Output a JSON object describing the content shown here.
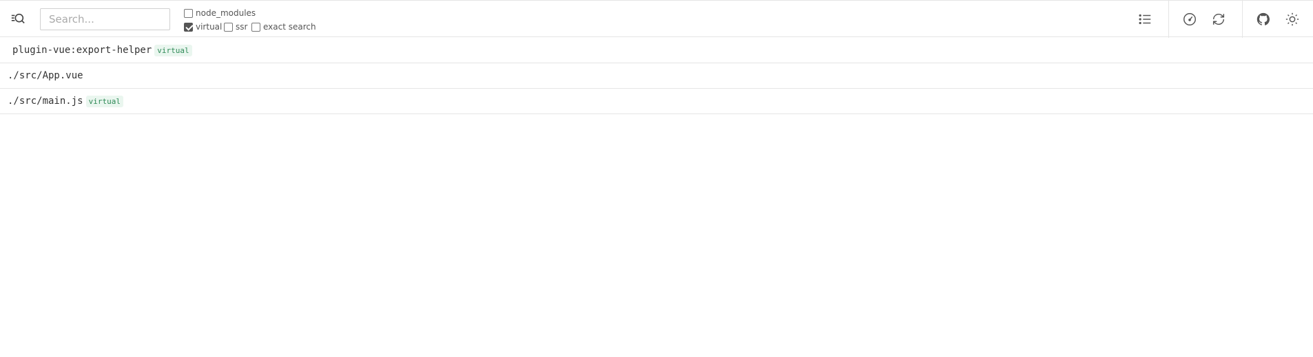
{
  "toolbar": {
    "logo_icon": "inspect-search-icon",
    "search": {
      "placeholder": "Search...",
      "value": ""
    },
    "filters": [
      {
        "label": "node_modules",
        "checked": false
      },
      {
        "label": "virtual",
        "checked": true
      },
      {
        "label": "ssr",
        "checked": false
      },
      {
        "label": "exact search",
        "checked": false
      }
    ],
    "right_icons": [
      "list-icon",
      "gauge-icon",
      "refresh-icon",
      "github-icon",
      "sun-icon"
    ]
  },
  "modules": [
    {
      "path": "plugin-vue:export-helper",
      "badge": "virtual"
    },
    {
      "path": "./src/App.vue",
      "badge": ""
    },
    {
      "path": "./src/main.js",
      "badge": "virtual"
    }
  ],
  "colors": {
    "badge_bg": "#eaf6ef",
    "badge_text": "#2f8a57",
    "border": "#e5e5e5"
  }
}
